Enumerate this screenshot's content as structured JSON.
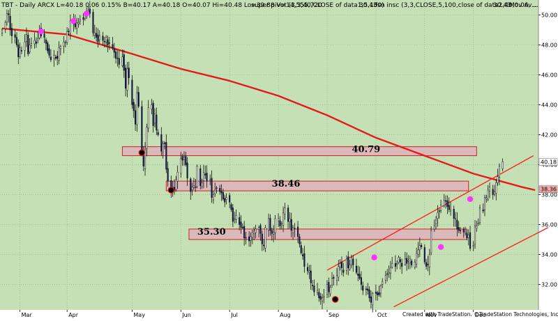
{
  "header": {
    "symbol": "TBT",
    "segments": [
      "TBT - Daily  ARCX  L=40.18  0.06  0.15%  B=40.17  A=40.18  O=40.07  Hi=40.48  Lo=39.88  V=14,555,720",
      "super pivot (3,3,40,CLOSE of data1,5,100)",
      "30.43",
      "fsn insc (3,3,CLOSE,5,100,close of data2,40,0.06, ...",
      "30.43",
      "Mov Av..."
    ]
  },
  "footer": {
    "credit": "Created with TradeStation. ©TradeStation Technologies, Inc. All rights reserved."
  },
  "colors": {
    "background": "#c5e0b4",
    "grid": "#8fa98f",
    "up_candle": "#ffffff",
    "down_candle": "#0d1a66",
    "moving_average": "#e31b1b",
    "zone_fill": "#d9b9b9",
    "zone_border": "#cc2222",
    "channel": "#ff1a1a",
    "pivot_high": "#ff33ff",
    "pivot_low": "#000000",
    "last_price_tag": "#ffffff",
    "ma_price_tag": "#f4a8a8"
  },
  "chart_data": {
    "type": "candlestick",
    "title": "",
    "ylim": [
      30.3,
      51
    ],
    "y_ticks": [
      "32.00",
      "34.00",
      "36.00",
      "38.00",
      "40.00",
      "42.00",
      "44.00",
      "46.00",
      "48.00",
      "50.00"
    ],
    "x_ticks": [
      "Mar",
      "Apr",
      "May",
      "Jun",
      "Jul",
      "Aug",
      "Sep",
      "Oct",
      "Nov",
      "Dec"
    ],
    "price_tags": [
      {
        "label": "40.18",
        "value": 40.18,
        "kind": "last"
      },
      {
        "label": "38.36",
        "value": 38.36,
        "kind": "ma"
      }
    ],
    "zones": [
      {
        "label": "40.79",
        "value": 40.79,
        "low": 40.6,
        "high": 41.2,
        "start_day": 74,
        "end_day": 292
      },
      {
        "label": "38.46",
        "value": 38.46,
        "low": 38.25,
        "high": 38.9,
        "start_day": 101,
        "end_day": 287
      },
      {
        "label": "35.30",
        "value": 35.3,
        "low": 35.0,
        "high": 35.7,
        "start_day": 115,
        "end_day": 286
      }
    ],
    "channel": [
      {
        "x": [
          200,
          327
        ],
        "y": [
          32.95,
          40.6
        ]
      },
      {
        "x": [
          241,
          336
        ],
        "y": [
          30.5,
          35.8
        ]
      }
    ],
    "moving_average": {
      "x": [
        0,
        40,
        80,
        110,
        140,
        170,
        200,
        230,
        260,
        290,
        320,
        328
      ],
      "y": [
        49.1,
        48.7,
        47.4,
        46.4,
        45.6,
        44.6,
        43.3,
        41.8,
        40.6,
        39.4,
        38.5,
        38.3
      ]
    },
    "pivot_highs": [
      {
        "x": 24,
        "y": 48.9
      },
      {
        "x": 44,
        "y": 49.6
      },
      {
        "x": 52,
        "y": 50.1
      },
      {
        "x": 229,
        "y": 33.8
      },
      {
        "x": 270,
        "y": 34.5
      },
      {
        "x": 288,
        "y": 37.7
      }
    ],
    "pivot_lows": [
      {
        "x": 86,
        "y": 40.8
      },
      {
        "x": 104,
        "y": 38.3
      },
      {
        "x": 205,
        "y": 31.0
      }
    ],
    "candles_x": [
      0,
      2,
      3,
      4,
      5,
      6,
      8,
      9,
      10,
      11,
      12,
      14,
      15,
      16,
      17,
      18,
      20,
      21,
      22,
      23,
      24,
      26,
      27,
      28,
      29,
      30,
      32,
      33,
      34,
      35,
      36,
      38,
      39,
      40,
      41,
      42,
      44,
      45,
      46,
      47,
      48,
      50,
      51,
      52,
      53,
      54,
      56,
      57,
      58,
      59,
      60,
      62,
      63,
      64,
      65,
      66,
      68,
      69,
      70,
      71,
      72,
      74,
      75,
      76,
      77,
      78,
      80,
      81,
      82,
      83,
      84,
      86,
      87,
      88,
      89,
      90,
      92,
      93,
      94,
      95,
      96,
      98,
      99,
      100,
      101,
      102,
      104,
      105,
      106,
      107,
      108,
      110,
      111,
      112,
      113,
      114,
      116,
      117,
      118,
      119,
      120,
      122,
      123,
      124,
      125,
      126,
      128,
      129,
      130,
      131,
      132,
      134,
      135,
      136,
      137,
      138,
      140,
      141,
      142,
      143,
      144,
      146,
      147,
      148,
      149,
      150,
      152,
      153,
      154,
      155,
      156,
      158,
      159,
      160,
      161,
      162,
      164,
      165,
      166,
      167,
      168,
      170,
      171,
      172,
      173,
      174,
      176,
      177,
      178,
      179,
      180,
      182,
      183,
      184,
      185,
      186,
      188,
      189,
      190,
      191,
      192,
      194,
      195,
      196,
      197,
      198,
      200,
      201,
      202,
      203,
      204,
      206,
      207,
      208,
      209,
      210,
      212,
      213,
      214,
      215,
      216,
      218,
      219,
      220,
      221,
      222,
      224,
      225,
      226,
      227,
      228,
      230,
      231,
      232,
      233,
      234,
      236,
      237,
      238,
      239,
      240,
      242,
      243,
      244,
      245,
      246,
      248,
      249,
      250,
      251,
      252,
      254,
      255,
      256,
      257,
      258,
      260,
      261,
      262,
      263,
      264,
      266,
      267,
      268,
      269,
      270,
      272,
      273,
      274,
      275,
      276,
      278,
      279,
      280,
      281,
      282,
      284,
      285,
      286,
      287,
      288,
      290,
      291,
      292,
      293,
      294,
      296,
      297,
      298,
      299,
      300,
      302,
      303,
      304,
      305,
      306,
      308,
      309,
      310,
      311,
      312,
      314,
      315,
      316,
      317,
      318,
      320,
      321,
      322,
      323,
      324,
      326,
      327
    ],
    "closes": [
      49.0,
      49.5,
      50.1,
      50.0,
      49.0,
      48.6,
      48.5,
      48.0,
      47.2,
      47.8,
      47.6,
      48.2,
      48.7,
      47.4,
      48.0,
      48.1,
      48.3,
      48.1,
      48.4,
      49.0,
      48.6,
      48.5,
      48.1,
      47.6,
      47.3,
      47.0,
      47.3,
      47.1,
      47.1,
      47.8,
      47.9,
      48.2,
      48.2,
      48.9,
      48.9,
      49.6,
      49.4,
      49.2,
      49.5,
      49.5,
      49.7,
      49.7,
      50.0,
      50.2,
      50.3,
      50.1,
      48.8,
      48.8,
      48.5,
      48.2,
      48.6,
      48.3,
      48.2,
      48.5,
      48.0,
      48.1,
      47.8,
      47.5,
      47.1,
      47.1,
      46.7,
      47.2,
      46.3,
      45.1,
      46.4,
      45.8,
      44.0,
      43.6,
      42.7,
      44.8,
      43.9,
      40.8,
      39.9,
      41.0,
      42.5,
      43.8,
      44.0,
      42.6,
      43.4,
      42.3,
      42.0,
      40.9,
      41.4,
      41.4,
      39.7,
      38.9,
      38.3,
      38.5,
      38.3,
      39.0,
      39.5,
      40.4,
      40.3,
      40.5,
      40.0,
      39.1,
      38.2,
      38.5,
      38.6,
      38.5,
      39.9,
      38.6,
      38.8,
      39.5,
      39.3,
      38.9,
      39.0,
      37.8,
      38.0,
      38.3,
      38.4,
      38.2,
      38.1,
      37.7,
      37.5,
      37.8,
      37.5,
      37.0,
      36.2,
      36.4,
      36.6,
      36.0,
      35.8,
      35.8,
      35.1,
      35.1,
      34.9,
      35.2,
      35.5,
      35.6,
      35.7,
      35.8,
      35.4,
      34.7,
      34.6,
      35.8,
      36.4,
      35.6,
      35.4,
      35.5,
      36.4,
      36.4,
      35.9,
      36.1,
      36.8,
      37.1,
      36.2,
      36.4,
      35.6,
      35.8,
      35.7,
      35.2,
      34.7,
      34.1,
      33.9,
      33.2,
      32.9,
      32.9,
      32.1,
      31.9,
      31.5,
      31.6,
      31.1,
      31.0,
      31.1,
      31.2,
      32.0,
      31.5,
      31.8,
      32.4,
      32.4,
      32.6,
      33.2,
      33.4,
      33.1,
      32.8,
      33.7,
      33.1,
      33.3,
      33.8,
      33.3,
      32.8,
      32.6,
      32.4,
      32.0,
      31.6,
      31.7,
      31.6,
      31.1,
      30.8,
      31.4,
      31.4,
      31.3,
      31.3,
      31.9,
      32.2,
      32.6,
      32.7,
      32.8,
      33.1,
      33.4,
      33.2,
      33.4,
      33.8,
      33.5,
      33.2,
      33.7,
      33.4,
      33.6,
      33.7,
      33.3,
      33.5,
      34.1,
      34.3,
      34.6,
      34.5,
      33.5,
      33.2,
      33.3,
      34.0,
      35.6,
      35.9,
      36.3,
      36.8,
      36.9,
      37.3,
      37.6,
      37.6,
      37.2,
      37.0,
      37.0,
      36.4,
      36.4,
      35.7,
      35.6,
      35.6,
      35.5,
      35.5,
      35.1,
      35.3,
      34.4,
      34.6,
      35.9,
      35.9,
      36.1,
      37.1,
      36.9,
      37.8,
      37.8,
      38.3,
      38.5,
      38.0,
      38.2,
      38.8,
      39.2,
      39.9,
      40.2
    ]
  }
}
